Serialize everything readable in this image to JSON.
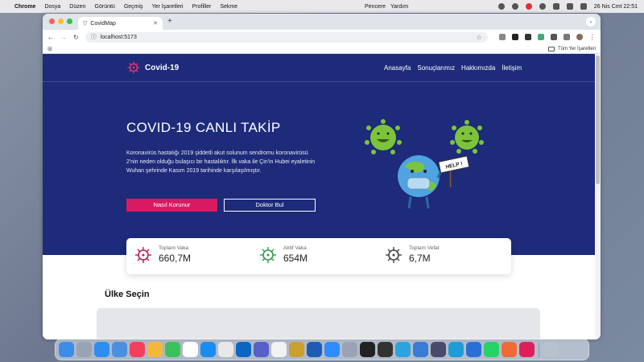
{
  "menubar": {
    "app": "Chrome",
    "items": [
      "Dosya",
      "Düzen",
      "Görüntü",
      "Geçmiş",
      "Yer İşaretleri",
      "Profiller",
      "Sekme"
    ],
    "right_items": [
      "Pencere",
      "Yardım"
    ],
    "datetime": "26 Nis Cmt  22:51"
  },
  "browser": {
    "tab_title": "CovidMap",
    "url": "localhost:5173",
    "bookmarks_all": "Tüm Yer İşaretleri"
  },
  "site": {
    "logo_text": "Covid-19",
    "nav": [
      "Anasayfa",
      "Sonuçlarımız",
      "Hakkımızda",
      "İletişim"
    ],
    "hero_title": "COVID-19 CANLI TAKİP",
    "hero_desc": "Koronavirüs hastalığı 2019 şiddetli akut solunum sendromu koronavirüsü 2'nin neden olduğu bulaşıcı bir hastalıktır. İlk vaka ile Çin'in Hubei eyaletinin Wuhan şehrinde Kasım 2019 tarihinde karşılaşılmıştır.",
    "btn_primary": "Nasıl Korunur",
    "btn_secondary": "Doktor Bul",
    "help_sign": "HELP !",
    "stats": [
      {
        "label": "Toplam Vaka",
        "value": "660,7M",
        "color": "#c2185b"
      },
      {
        "label": "Aktif Vaka",
        "value": "654M",
        "color": "#2e9d4a"
      },
      {
        "label": "Toplam Vefat",
        "value": "6,7M",
        "color": "#444444"
      }
    ],
    "section_title": "Ülke Seçin"
  },
  "colors": {
    "hero_bg": "#1d2b7a",
    "accent": "#d81b60"
  }
}
